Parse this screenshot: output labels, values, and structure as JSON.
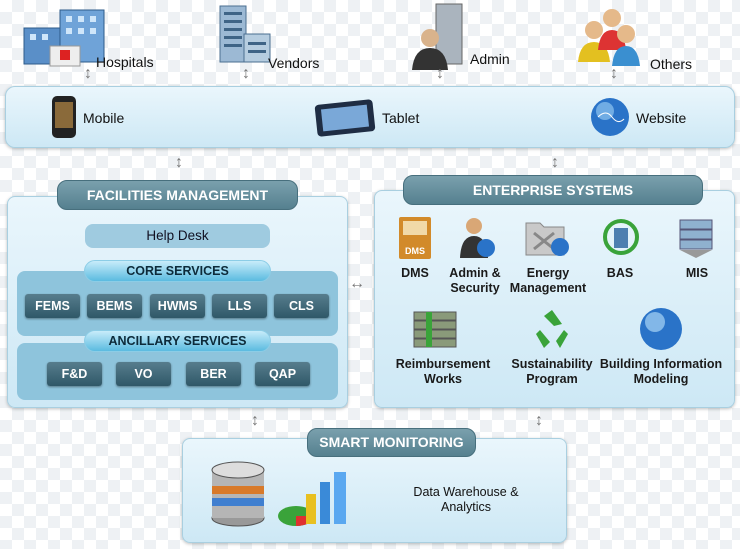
{
  "stakeholders": [
    {
      "label": "Hospitals"
    },
    {
      "label": "Vendors"
    },
    {
      "label": "Admin"
    },
    {
      "label": "Others"
    }
  ],
  "channels": [
    {
      "label": "Mobile"
    },
    {
      "label": "Tablet"
    },
    {
      "label": "Website"
    }
  ],
  "facilities": {
    "title": "FACILITIES MANAGEMENT",
    "help_desk": "Help Desk",
    "core": {
      "title": "CORE SERVICES",
      "items": [
        "FEMS",
        "BEMS",
        "HWMS",
        "LLS",
        "CLS"
      ]
    },
    "ancillary": {
      "title": "ANCILLARY SERVICES",
      "items": [
        "F&D",
        "VO",
        "BER",
        "QAP"
      ]
    }
  },
  "enterprise": {
    "title": "ENTERPRISE SYSTEMS",
    "dms_icon_text": "DMS",
    "items": [
      {
        "line1": "DMS",
        "line2": ""
      },
      {
        "line1": "Admin &",
        "line2": "Security"
      },
      {
        "line1": "Energy",
        "line2": "Management"
      },
      {
        "line1": "BAS",
        "line2": ""
      },
      {
        "line1": "MIS",
        "line2": ""
      },
      {
        "line1": "Reimbursement",
        "line2": "Works"
      },
      {
        "line1": "Sustainability",
        "line2": "Program"
      },
      {
        "line1": "Building Information",
        "line2": "Modeling"
      }
    ]
  },
  "monitoring": {
    "title": "SMART MONITORING",
    "line1": "Data Warehouse &",
    "line2": "Analytics"
  }
}
